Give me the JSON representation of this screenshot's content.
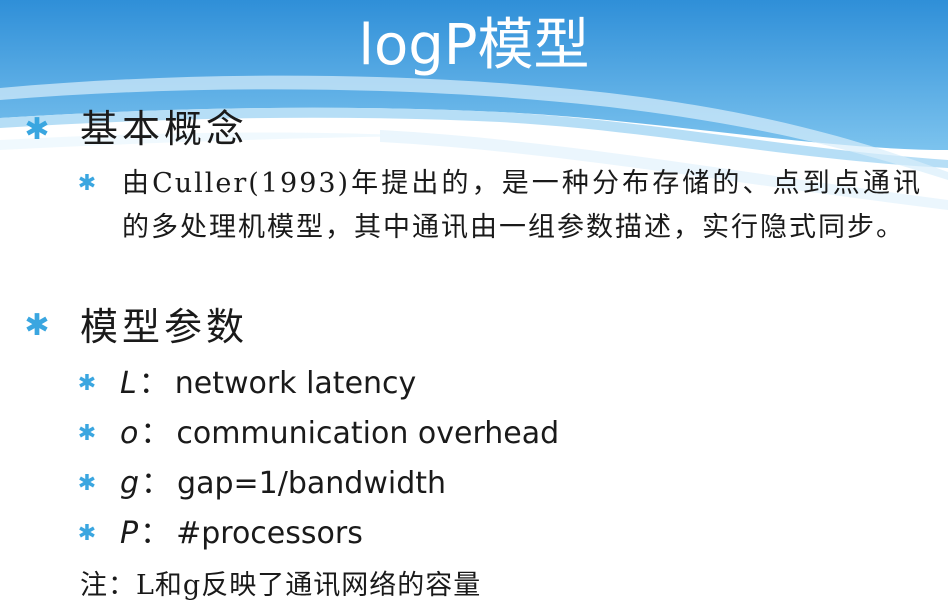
{
  "slide": {
    "title": "logP模型",
    "sections": [
      {
        "heading": "基本概念",
        "paragraph": "由Culler(1993)年提出的，是一种分布存储的、点到点通讯的多处理机模型，其中通讯由一组参数描述，实行隐式同步。"
      },
      {
        "heading": "模型参数",
        "params": [
          {
            "symbol": "L",
            "separator": "：",
            "description": "network latency"
          },
          {
            "symbol": "o",
            "separator": "：",
            "description": "communication overhead"
          },
          {
            "symbol": "g",
            "separator": "：",
            "description": "gap=1/bandwidth"
          },
          {
            "symbol": "P",
            "separator": "：",
            "description": "#processors"
          }
        ]
      }
    ],
    "note": "注：L和g反映了通讯网络的容量"
  },
  "theme": {
    "header_top": "#2f8fd8",
    "header_bottom": "#7cc3ee",
    "bullet": "#3aa6e0",
    "bullet_icon": "asterisk-icon"
  }
}
